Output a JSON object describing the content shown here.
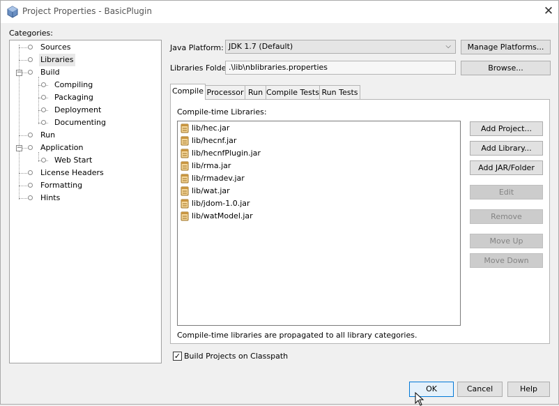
{
  "window": {
    "title": "Project Properties - BasicPlugin",
    "close_glyph": "✕"
  },
  "categories": {
    "label": "Categories:",
    "items": [
      {
        "label": "Sources"
      },
      {
        "label": "Libraries",
        "selected": true
      },
      {
        "label": "Build",
        "expanded": true
      },
      {
        "label": "Compiling"
      },
      {
        "label": "Packaging"
      },
      {
        "label": "Deployment"
      },
      {
        "label": "Documenting"
      },
      {
        "label": "Run"
      },
      {
        "label": "Application",
        "expanded": true
      },
      {
        "label": "Web Start"
      },
      {
        "label": "License Headers"
      },
      {
        "label": "Formatting"
      },
      {
        "label": "Hints"
      }
    ]
  },
  "platform": {
    "label": "Java Platform:",
    "value": "JDK 1.7 (Default)",
    "manage_button": "Manage Platforms..."
  },
  "libraries_folder": {
    "label": "Libraries Folder:",
    "value": ".\\lib\\nblibraries.properties",
    "browse_button": "Browse..."
  },
  "tabs": [
    {
      "label": "Compile",
      "active": true
    },
    {
      "label": "Processor"
    },
    {
      "label": "Run"
    },
    {
      "label": "Compile Tests"
    },
    {
      "label": "Run Tests"
    }
  ],
  "compile": {
    "list_label": "Compile-time Libraries:",
    "libraries": [
      "lib/hec.jar",
      "lib/hecnf.jar",
      "lib/hecnfPlugin.jar",
      "lib/rma.jar",
      "lib/rmadev.jar",
      "lib/wat.jar",
      "lib/jdom-1.0.jar",
      "lib/watModel.jar"
    ],
    "buttons": {
      "add_project": "Add Project...",
      "add_library": "Add Library...",
      "add_jar": "Add JAR/Folder",
      "edit": "Edit",
      "remove": "Remove",
      "move_up": "Move Up",
      "move_down": "Move Down"
    },
    "note": "Compile-time libraries are propagated to all library categories."
  },
  "build_on_classpath": {
    "label": "Build Projects on Classpath",
    "checked": true,
    "check_glyph": "✓"
  },
  "footer": {
    "ok": "OK",
    "cancel": "Cancel",
    "help": "Help"
  },
  "colors": {
    "accent": "#0078d7",
    "disabled_text": "#838383"
  }
}
